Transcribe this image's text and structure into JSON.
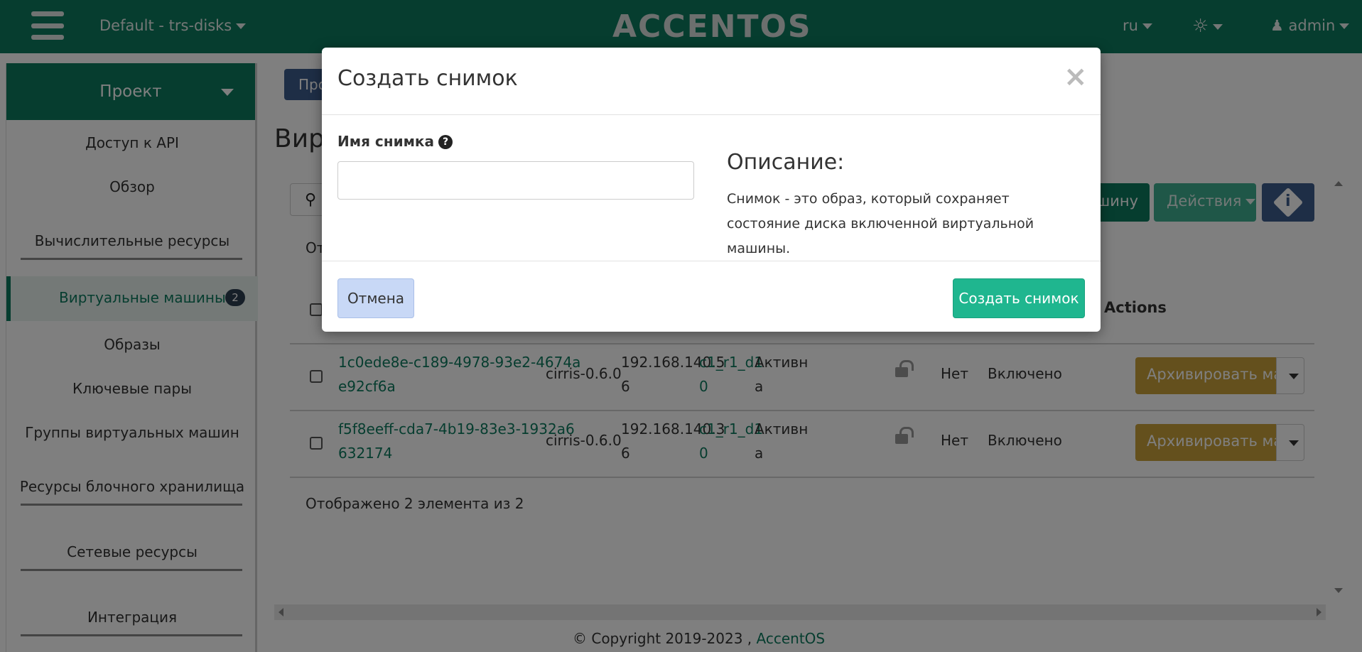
{
  "navbar": {
    "project_switch": "Default - trs-disks",
    "logo": "ACCENTOS",
    "language": "ru",
    "user": "admin"
  },
  "sidebar": {
    "header": "Проект",
    "items": [
      {
        "label": "Доступ к API"
      },
      {
        "label": "Обзор"
      },
      {
        "label": "Вычислительные ресурсы"
      },
      {
        "label": "Виртуальные машины",
        "badge": "2"
      },
      {
        "label": "Образы"
      },
      {
        "label": "Ключевые пары"
      },
      {
        "label": "Группы виртуальных машин"
      },
      {
        "label": "Ресурсы блочного хранилища"
      },
      {
        "label": "Сетевые ресурсы"
      },
      {
        "label": "Интеграция"
      }
    ]
  },
  "main": {
    "breadcrumb_button": "Про",
    "page_title": "Вирт",
    "launch_button": "ашину",
    "actions_button": "Действия",
    "filter_label": "От",
    "actions_header": "Actions",
    "rows": [
      {
        "name_line1": "1c0ede8e-c189-4978-93e2-4674a",
        "name_line2": "e92cf6a",
        "image": "cirris-0.6.0",
        "ip_line1": "192.168.140.5",
        "ip_line2": "6",
        "flavor_line1": "c1_r1_d1",
        "flavor_line2": "0",
        "status_line1": "Активн",
        "status_line2": "а",
        "locked": "Нет",
        "power": "Включено",
        "action": "Архивировать машину"
      },
      {
        "name_line1": "f5f8eeff-cda7-4b19-83e3-1932a6",
        "name_line2": "632174",
        "image": "cirris-0.6.0",
        "ip_line1": "192.168.140.3",
        "ip_line2": "6",
        "flavor_line1": "c1_r1_d1",
        "flavor_line2": "0",
        "status_line1": "Активн",
        "status_line2": "а",
        "locked": "Нет",
        "power": "Включено",
        "action": "Архивировать машину"
      }
    ],
    "shown_count": "Отображено 2 элемента из 2"
  },
  "footer": {
    "copyright": "© Copyright 2019-2023 ,",
    "link": "AccentOS"
  },
  "modal": {
    "title": "Создать снимок",
    "close": "×",
    "field_label": "Имя снимка",
    "field_value": "",
    "description_title": "Описание:",
    "description_text": "Снимок - это образ, который сохраняет состояние диска включенной виртуальной машины.",
    "cancel": "Отмена",
    "submit": "Создать снимок"
  },
  "colors": {
    "brand": "#0d7a5f",
    "primary_button": "#1fb68f",
    "archive_button": "#c9a13a",
    "info_button": "#3c5c8c"
  }
}
